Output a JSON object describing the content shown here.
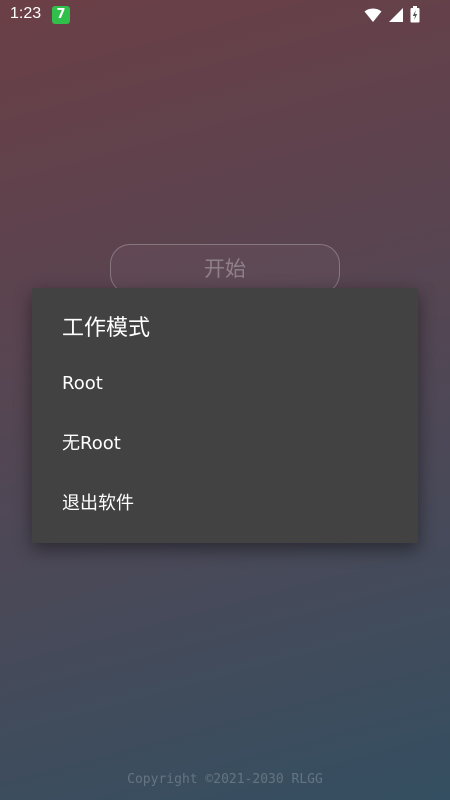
{
  "status_bar": {
    "time": "1:23",
    "notification_badge": "7",
    "icons": [
      "wifi-icon",
      "signal-icon",
      "battery-icon"
    ]
  },
  "main": {
    "start_label": "开始",
    "copyright": "Copyright ©2021-2030 RLGG"
  },
  "dialog": {
    "title": "工作模式",
    "items": [
      {
        "label": "Root"
      },
      {
        "label": "无Root"
      },
      {
        "label": "退出软件"
      }
    ]
  },
  "colors": {
    "dialog_bg": "#424242",
    "badge_green": "#2fbf4a"
  }
}
